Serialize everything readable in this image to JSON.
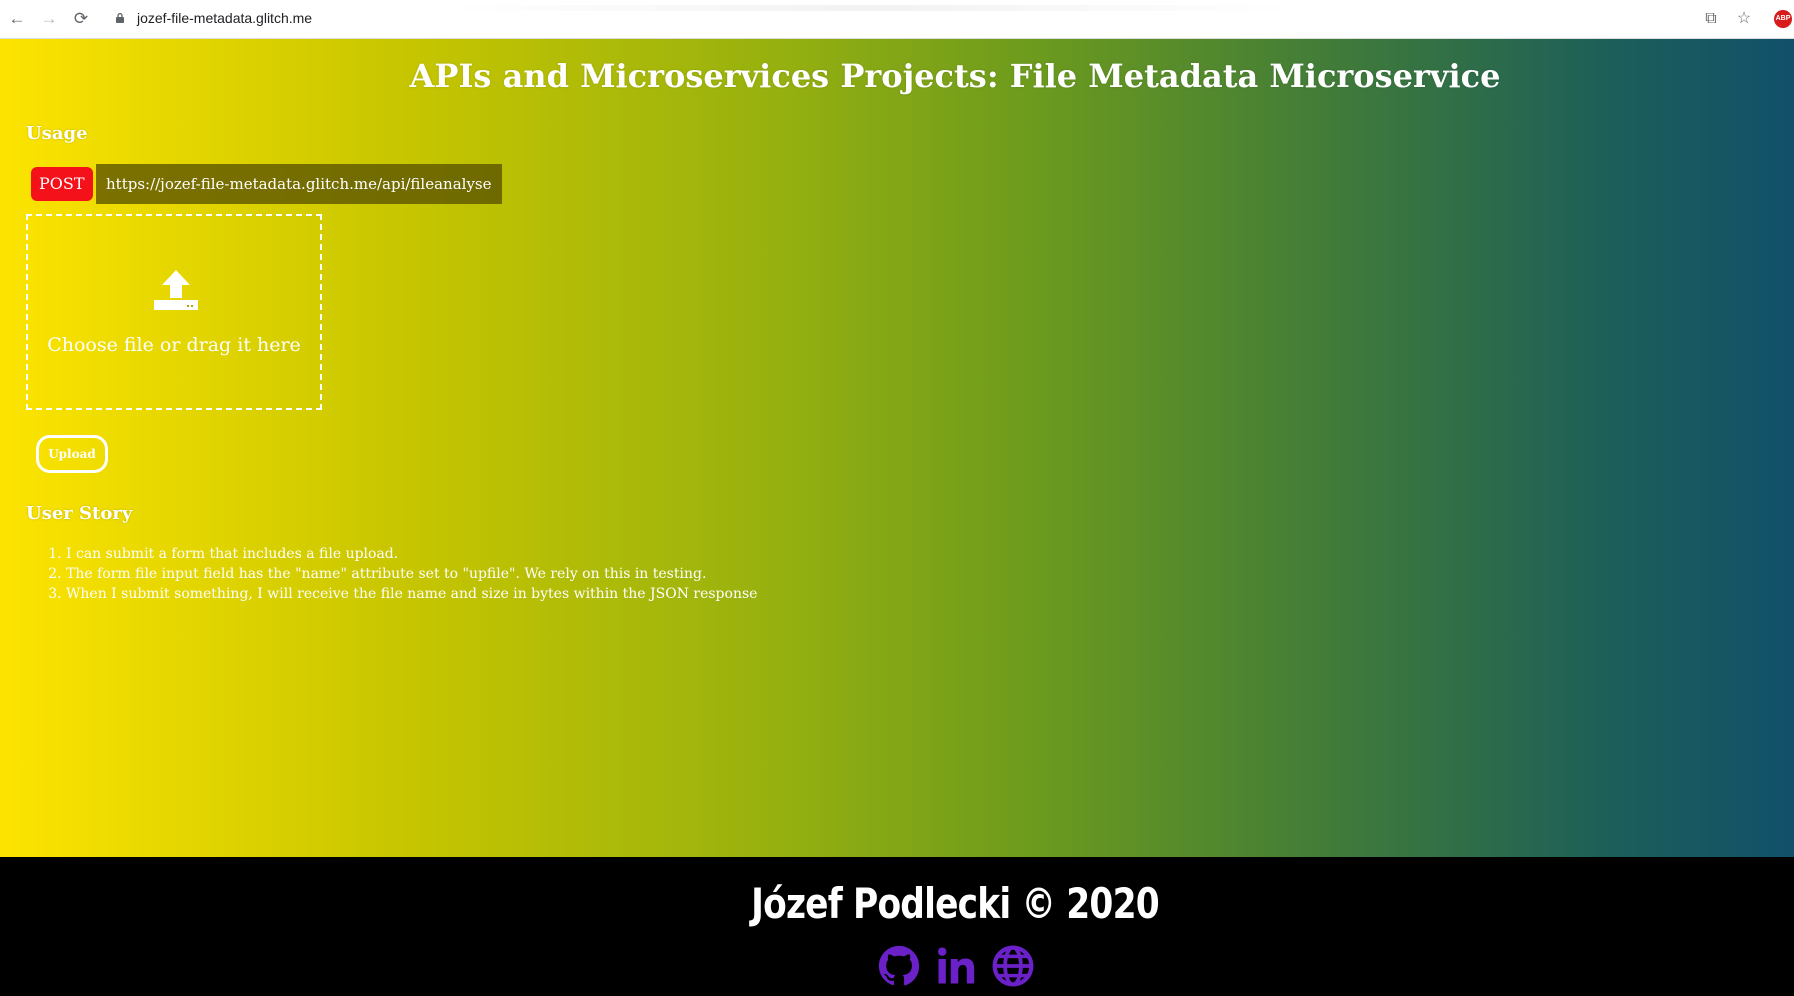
{
  "browser": {
    "url": "jozef-file-metadata.glitch.me",
    "back_glyph": "←",
    "forward_glyph": "→",
    "reload_glyph": "⟳",
    "star_glyph": "☆",
    "translate_glyph": "⧉",
    "abp_label": "ABP"
  },
  "page": {
    "title": "APIs and Microservices Projects: File Metadata Microservice",
    "usage_heading": "Usage",
    "method": "POST",
    "endpoint": "https://jozef-file-metadata.glitch.me/api/fileanalyse",
    "dropzone_label": "Choose file or drag it here",
    "upload_button": "Upload",
    "user_story_heading": "User Story",
    "user_stories": [
      "I can submit a form that includes a file upload.",
      "The form file input field has the \"name\" attribute set to \"upfile\". We rely on this in testing.",
      "When I submit something, I will receive the file name and size in bytes within the JSON response"
    ]
  },
  "footer": {
    "copyright": "Józef Podlecki © 2020",
    "icon_color": "#6b21c8",
    "icons": [
      "github-icon",
      "linkedin-icon",
      "globe-icon"
    ]
  },
  "colors": {
    "gradient_start": "#fde400",
    "gradient_end": "#11506a",
    "badge_red": "#f4111a"
  }
}
